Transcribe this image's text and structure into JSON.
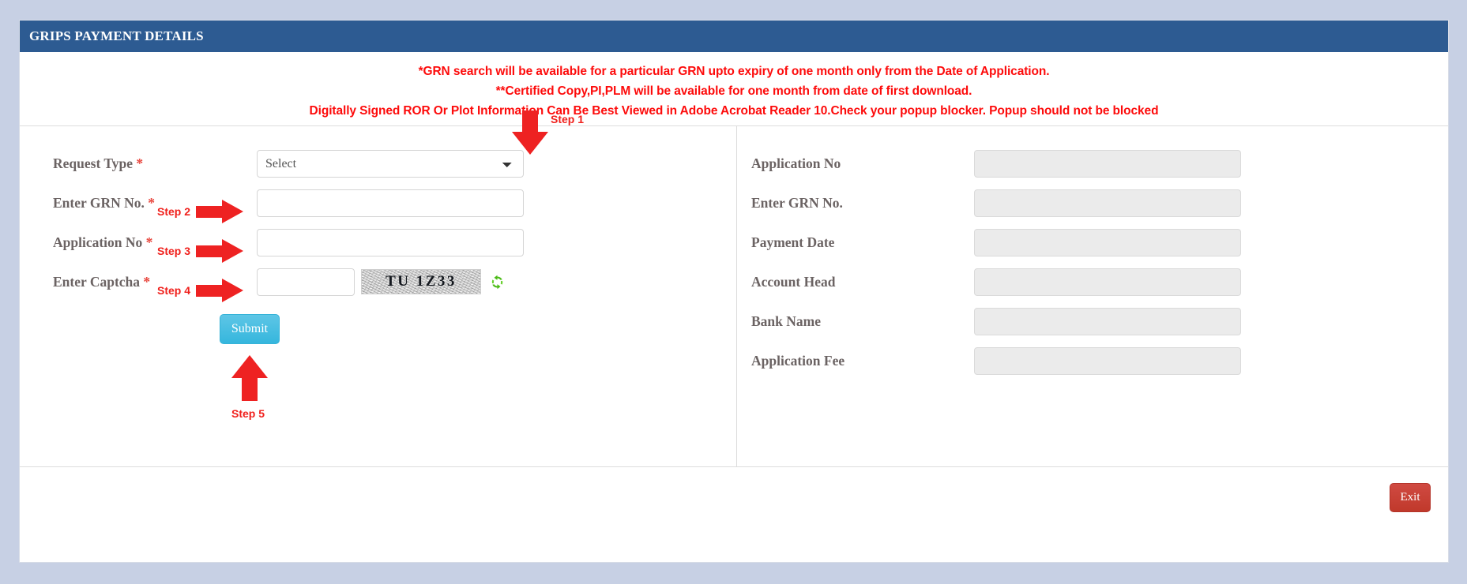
{
  "header": {
    "title": "GRIPS PAYMENT DETAILS"
  },
  "notices": [
    "*GRN search will be available for a particular GRN upto expiry of one month only from the Date of Application.",
    "**Certified Copy,PI,PLM will be available for one month from date of first download.",
    "Digitally Signed ROR Or Plot Information Can Be Best Viewed in Adobe Acrobat Reader 10.Check your popup blocker. Popup should not be blocked"
  ],
  "left_form": {
    "request_type": {
      "label": "Request Type",
      "required": "*",
      "selected": "Select",
      "options": [
        "Select"
      ],
      "step": "Step 1"
    },
    "grn_no": {
      "label": "Enter GRN No.",
      "required": "*",
      "value": "",
      "placeholder": "",
      "step": "Step 2"
    },
    "application_no": {
      "label": "Application No",
      "required": "*",
      "value": "",
      "placeholder": "",
      "step": "Step 3"
    },
    "captcha": {
      "label": "Enter Captcha",
      "required": "*",
      "value": "",
      "placeholder": "",
      "image_text": "TU 1Z33",
      "refresh_icon": "refresh-icon",
      "step": "Step 4"
    },
    "submit": {
      "label": "Submit",
      "step": "Step 5"
    }
  },
  "right_panel": {
    "fields": [
      {
        "label": "Application No",
        "value": ""
      },
      {
        "label": "Enter GRN No.",
        "value": ""
      },
      {
        "label": "Payment Date",
        "value": ""
      },
      {
        "label": "Account Head",
        "value": ""
      },
      {
        "label": "Bank Name",
        "value": ""
      },
      {
        "label": "Application Fee",
        "value": ""
      }
    ]
  },
  "footer": {
    "exit_label": "Exit"
  },
  "colors": {
    "header_blue": "#2d5b92",
    "notice_red": "#fd0b0b",
    "arrow_red": "#ee2222",
    "submit_blue": "#35b6dd",
    "exit_red": "#c0392b",
    "page_background": "#c7d0e4",
    "readonly_field": "#ebebeb"
  }
}
